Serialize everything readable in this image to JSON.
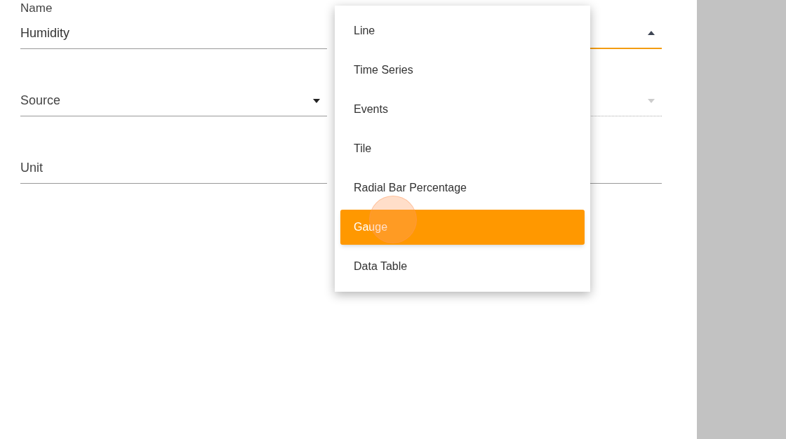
{
  "left_fields": [
    {
      "kind": "text",
      "label": "Name",
      "value": "Humidity"
    },
    {
      "kind": "select",
      "placeholder": "Source",
      "expanded": false,
      "disabled": false
    },
    {
      "kind": "text",
      "placeholder": "Unit"
    }
  ],
  "right_fields": [
    {
      "kind": "select",
      "expanded": true,
      "disabled": false
    },
    {
      "kind": "select",
      "expanded": false,
      "disabled": true
    },
    {
      "kind": "text"
    }
  ],
  "menu": {
    "options": [
      {
        "label": "Line",
        "selected": false
      },
      {
        "label": "Time Series",
        "selected": false
      },
      {
        "label": "Events",
        "selected": false
      },
      {
        "label": "Tile",
        "selected": false
      },
      {
        "label": "Radial Bar Percentage",
        "selected": false
      },
      {
        "label": "Gauge",
        "selected": true
      },
      {
        "label": "Data Table",
        "selected": false
      }
    ]
  }
}
